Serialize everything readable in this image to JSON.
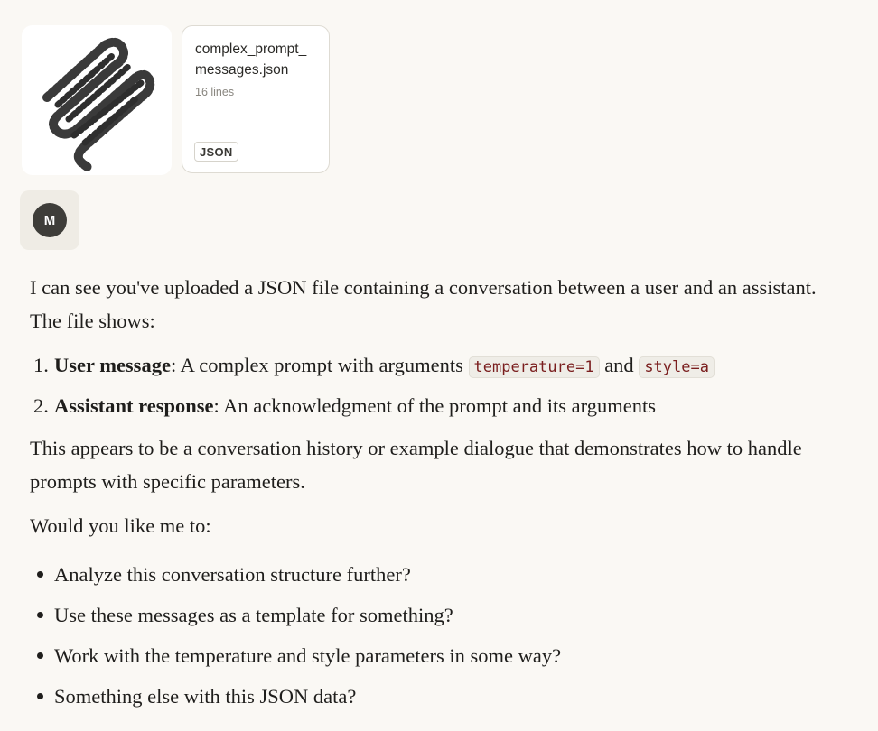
{
  "attachments": {
    "file": {
      "name": "complex_prompt_messages.json",
      "lines": "16 lines",
      "type": "JSON"
    }
  },
  "user": {
    "avatar_initial": "M"
  },
  "response": {
    "intro": "I can see you've uploaded a JSON file containing a conversation between a user and an assistant. The file shows:",
    "items": [
      {
        "num": "1.",
        "title": "User message",
        "text_before": ": A complex prompt with arguments ",
        "code1": "temperature=1",
        "text_mid": " and ",
        "code2": "style=a"
      },
      {
        "num": "2.",
        "title": "Assistant response",
        "text": ": An acknowledgment of the prompt and its arguments"
      }
    ],
    "paragraph": "This appears to be a conversation history or example dialogue that demonstrates how to handle prompts with specific parameters.",
    "question": "Would you like me to:",
    "options": [
      "Analyze this conversation structure further?",
      "Use these messages as a template for something?",
      "Work with the temperature and style parameters in some way?",
      "Something else with this JSON data?"
    ]
  }
}
